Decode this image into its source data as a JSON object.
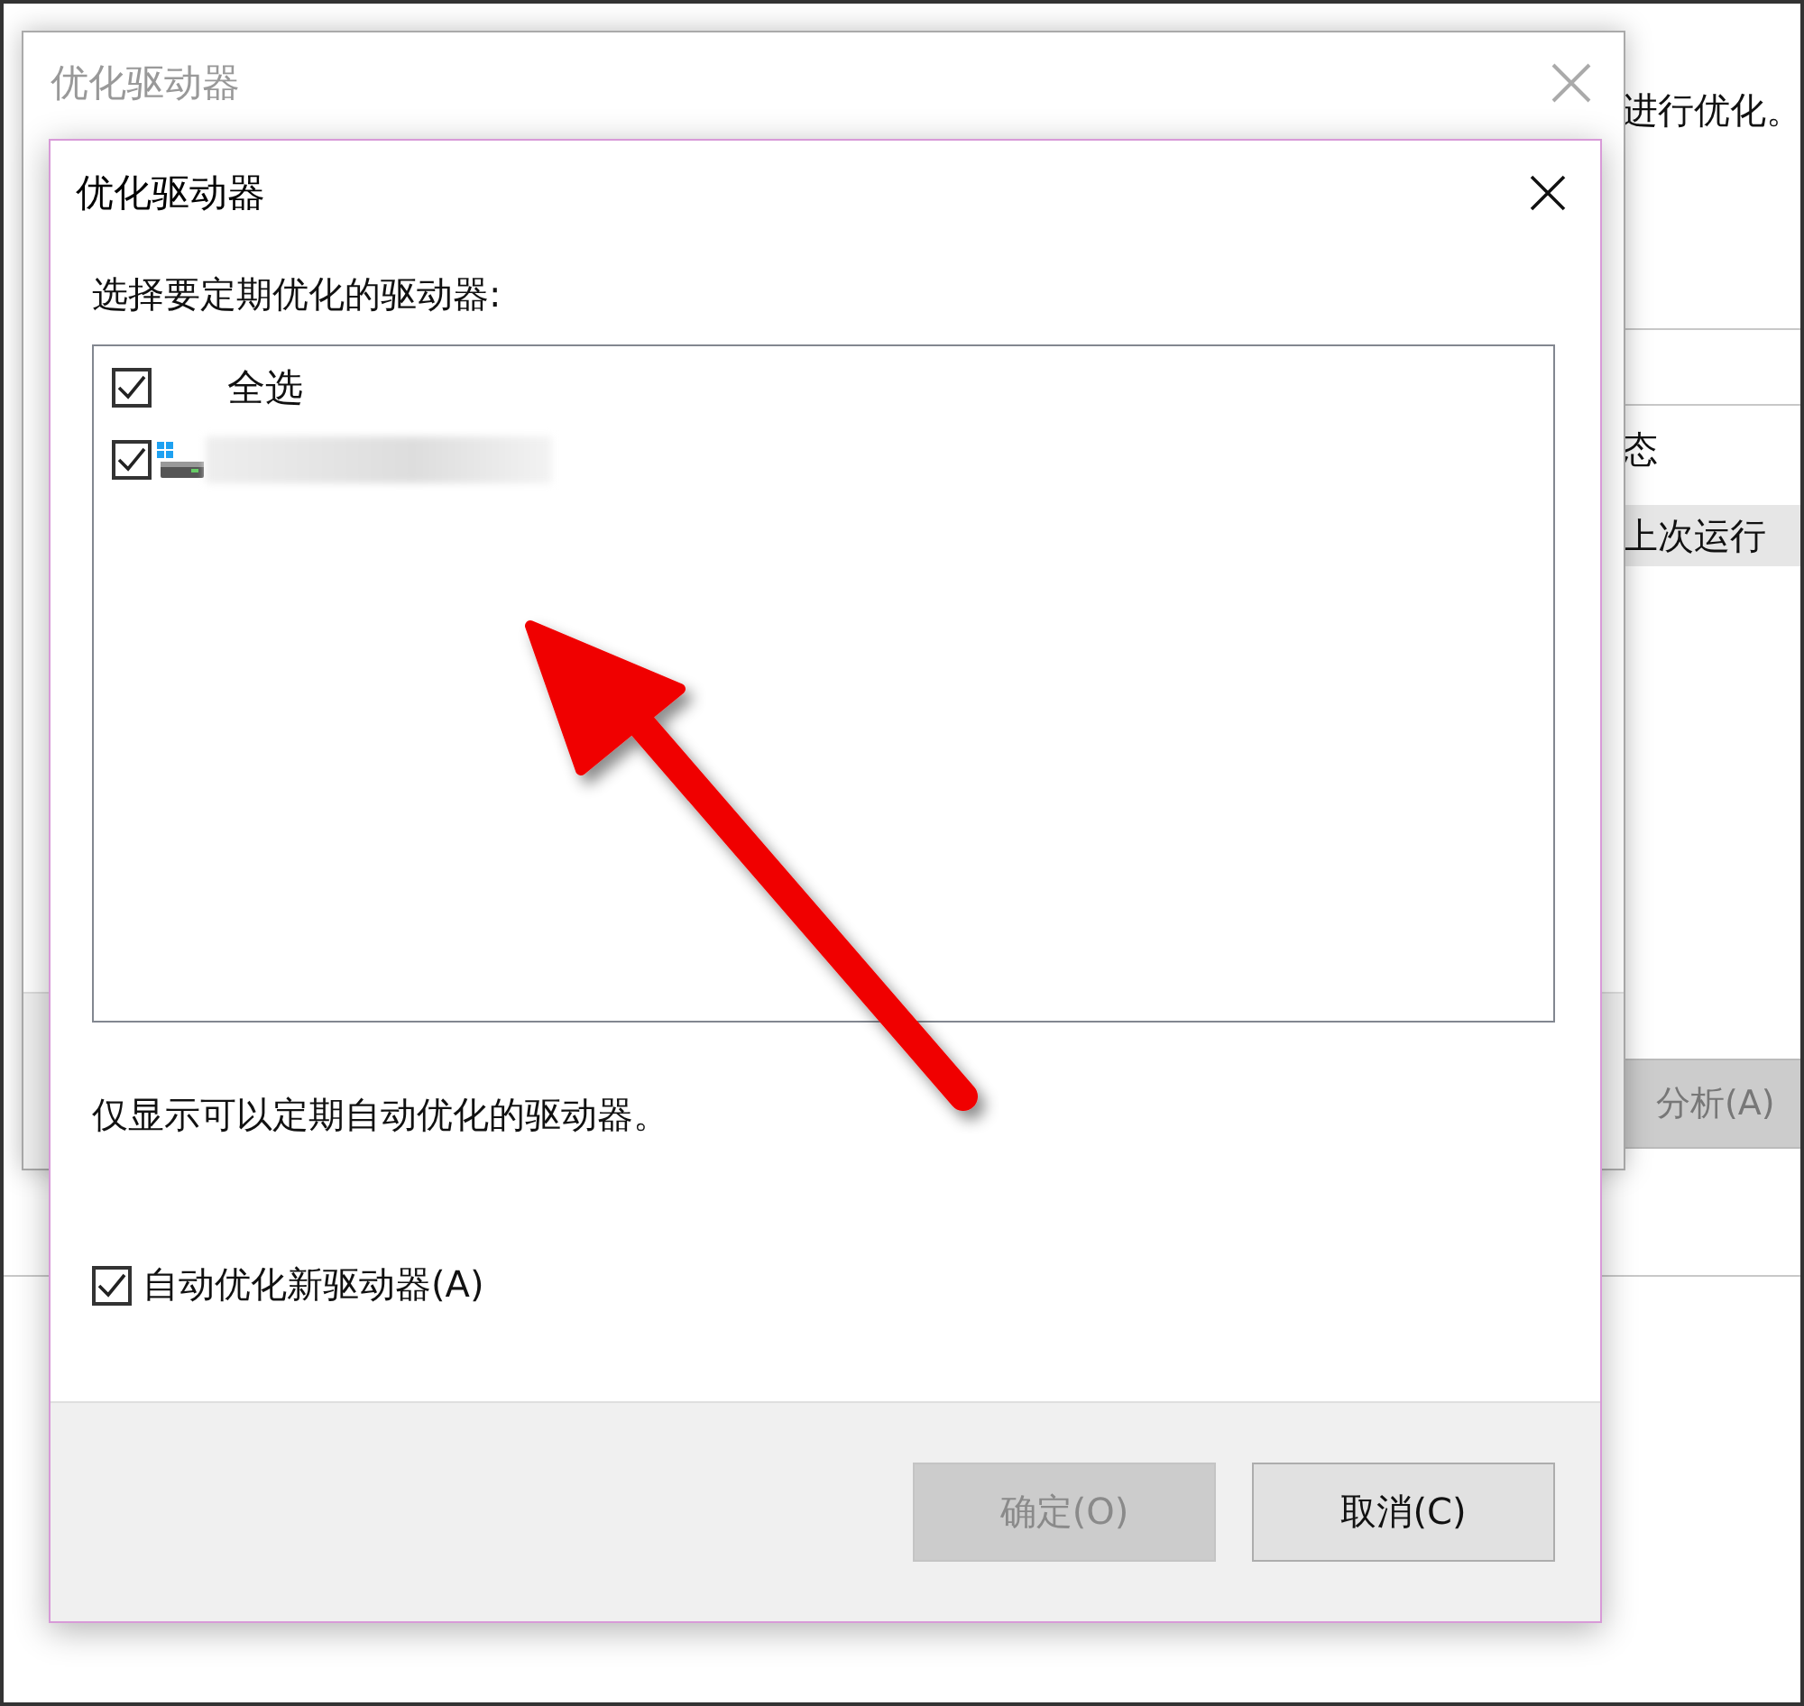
{
  "background_app": {
    "description": "进行优化。",
    "column_header": "态",
    "selected_cell": "上次运行",
    "button": "分析(A)"
  },
  "back_dialog": {
    "title": "优化驱动器"
  },
  "dialog": {
    "title": "优化驱动器",
    "instruction": "选择要定期优化的驱动器:",
    "drives": [
      {
        "kind": "select-all",
        "label": "全选",
        "checked": true
      },
      {
        "kind": "drive",
        "checked": true
      }
    ],
    "note": "仅显示可以定期自动优化的驱动器。",
    "auto_optimize": {
      "label": "自动优化新驱动器(A)",
      "checked": true
    },
    "buttons": [
      {
        "label": "确定(O)",
        "disabled": true
      },
      {
        "label": "取消(C)",
        "disabled": false
      }
    ]
  }
}
